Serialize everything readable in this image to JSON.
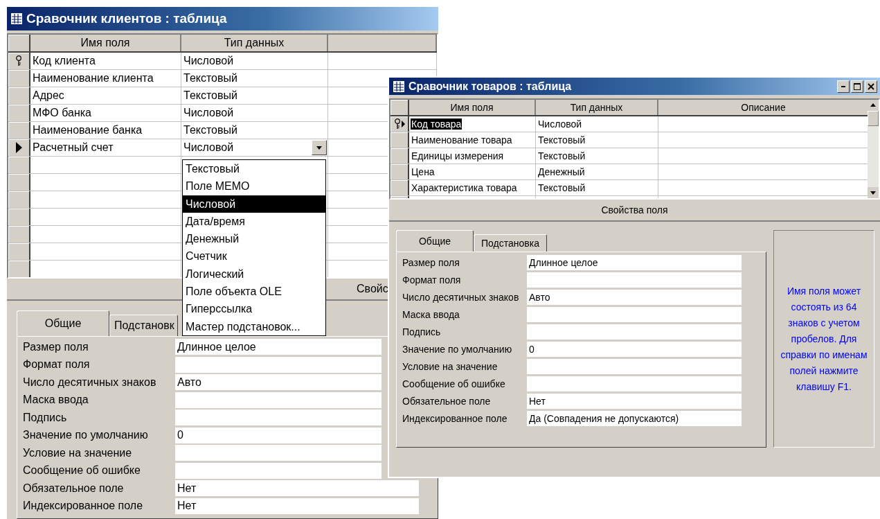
{
  "windows": [
    {
      "title": "Сравочник клиентов : таблица",
      "window_buttons": false,
      "columns": [
        "Имя поля",
        "Тип данных"
      ],
      "rows": [
        {
          "name": "Код клиента",
          "type": "Числовой",
          "primary_key": true,
          "current": false,
          "name_selected": false
        },
        {
          "name": "Наименование клиента",
          "type": "Текстовый",
          "primary_key": false,
          "current": false,
          "name_selected": false
        },
        {
          "name": "Адрес",
          "type": "Текстовый",
          "primary_key": false,
          "current": false,
          "name_selected": false
        },
        {
          "name": "МФО банка",
          "type": "Числовой",
          "primary_key": false,
          "current": false,
          "name_selected": false
        },
        {
          "name": "Наименование банка",
          "type": "Текстовый",
          "primary_key": false,
          "current": false,
          "name_selected": false
        },
        {
          "name": "Расчетный счет",
          "type": "Числовой",
          "primary_key": false,
          "current": true,
          "name_selected": false,
          "dropdown": [
            {
              "label": "Текстовый",
              "selected": false
            },
            {
              "label": "Поле MEMO",
              "selected": false
            },
            {
              "label": "Числовой",
              "selected": true
            },
            {
              "label": "Дата/время",
              "selected": false
            },
            {
              "label": "Денежный",
              "selected": false
            },
            {
              "label": "Счетчик",
              "selected": false
            },
            {
              "label": "Логический",
              "selected": false
            },
            {
              "label": "Поле объекта OLE",
              "selected": false
            },
            {
              "label": "Гиперссылка",
              "selected": false
            },
            {
              "label": "Мастер подстановок...",
              "selected": false
            }
          ]
        }
      ],
      "properties_header": "Свойс",
      "tabs": [
        {
          "label": "Общие",
          "selected": true
        },
        {
          "label": "Подстановк",
          "selected": false
        }
      ],
      "properties": [
        {
          "label": "Размер поля",
          "value": "Длинное целое"
        },
        {
          "label": "Формат поля"
        },
        {
          "label": "Число десятичных знаков",
          "value": "Авто"
        },
        {
          "label": "Маска ввода"
        },
        {
          "label": "Подпись"
        },
        {
          "label": "Значение по умолчанию",
          "value": "0"
        },
        {
          "label": "Условие на значение"
        },
        {
          "label": "Сообщение об ошибке"
        },
        {
          "label": "Обязательное поле",
          "value": "Нет"
        },
        {
          "label": "Индексированное поле",
          "value": "Нет"
        }
      ]
    },
    {
      "title": "Сравочник товаров : таблица",
      "window_buttons": true,
      "columns": [
        "Имя поля",
        "Тип данных",
        "Описание"
      ],
      "rows": [
        {
          "name": "Код товара",
          "type": "Числовой",
          "primary_key": true,
          "current": true,
          "name_selected": true
        },
        {
          "name": "Наименование товара",
          "type": "Текстовый",
          "primary_key": false,
          "current": false,
          "name_selected": false
        },
        {
          "name": "Единицы измерения",
          "type": "Текстовый",
          "primary_key": false,
          "current": false,
          "name_selected": false
        },
        {
          "name": "Цена",
          "type": "Денежный",
          "primary_key": false,
          "current": false,
          "name_selected": false
        },
        {
          "name": "Характеристика товара",
          "type": "Текстовый",
          "primary_key": false,
          "current": false,
          "name_selected": false
        }
      ],
      "properties_header": "Свойства поля",
      "tabs": [
        {
          "label": "Общие",
          "selected": true
        },
        {
          "label": "Подстановка",
          "selected": false
        }
      ],
      "properties": [
        {
          "label": "Размер поля",
          "value": "Длинное целое"
        },
        {
          "label": "Формат поля"
        },
        {
          "label": "Число десятичных знаков",
          "value": "Авто"
        },
        {
          "label": "Маска ввода"
        },
        {
          "label": "Подпись"
        },
        {
          "label": "Значение по умолчанию",
          "value": "0"
        },
        {
          "label": "Условие на значение"
        },
        {
          "label": "Сообщение об ошибке"
        },
        {
          "label": "Обязательное поле",
          "value": "Нет"
        },
        {
          "label": "Индексированное поле",
          "value": "Да (Совпадения не допускаются)"
        }
      ],
      "hint": "Имя поля может состоять из 64 знаков с учетом пробелов.  Для справки по именам полей нажмите клавишу F1."
    }
  ]
}
